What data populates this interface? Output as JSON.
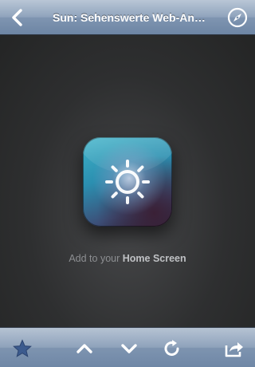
{
  "navbar": {
    "title": "Sun: Sehenswerte Web-An…",
    "back_icon": "chevron-left-icon",
    "compass_icon": "compass-icon"
  },
  "main": {
    "app_icon": "sun-icon",
    "home_prefix": "Add to your ",
    "home_bold": "Home Screen"
  },
  "toolbar": {
    "icons": [
      "star-icon",
      "arrow-up-icon",
      "arrow-down-icon",
      "reload-icon",
      "share-icon"
    ]
  },
  "colors": {
    "bar_blue": "#7f95b1",
    "background": "#2a2b2c",
    "star": "#3c5b8e"
  }
}
